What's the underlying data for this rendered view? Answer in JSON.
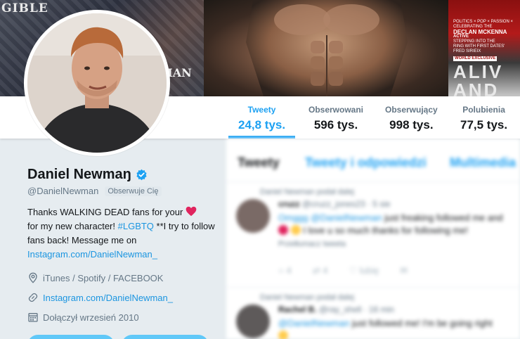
{
  "banner": {
    "left_text_top": "GIBLE",
    "left_text_bottom": "MAN",
    "magazine": {
      "line1": "POLITICS × POP × PASSION ×",
      "line2": "CELEBRATING THE",
      "line3": "DECLAN MCKENNA",
      "line4": "ACTIVE",
      "line5": "STEPPING INTO THE",
      "line6": "RING WITH FIRST DATES'",
      "line7": "FRED SIRIEIX",
      "exclusive": "WORLD EXCLUSIVE",
      "big1": "ALIV",
      "big2": "AND"
    }
  },
  "nav": {
    "stats": [
      {
        "label": "Tweety",
        "value": "24,8 tys."
      },
      {
        "label": "Obserwowani",
        "value": "596 tys."
      },
      {
        "label": "Obserwujący",
        "value": "998 tys."
      },
      {
        "label": "Polubienia",
        "value": "77,5 tys."
      }
    ]
  },
  "profile": {
    "name": "Daniel Newmaŋ",
    "handle": "@DanielNewman",
    "follows_you": "Obserwuje Cię",
    "bio": {
      "part1": "Thanks WALKING DEAD fans for your",
      "part2": "for my new character!",
      "hashtag": "#LGBTQ",
      "part3": "**I try to follow fans back! Message me on",
      "link": "Instagram.com/DanielNewman_"
    },
    "location": "iTunes / Spotify / FACEBOOK",
    "website": "Instagram.com/DanielNewman_",
    "joined": "Dołączył wrzesień 2010"
  },
  "timeline": {
    "tabs": [
      "Tweety",
      "Tweety i odpowiedzi",
      "Multimedia"
    ],
    "tweets": [
      {
        "retweeted_by": "Daniel Newman podał dalej",
        "author": "cruzz",
        "meta": "@cruzz_jones23 · 5 sie",
        "text_mention": "Omggg @DanielNewman",
        "text": "just freaking followed me and",
        "text2": "I love u so much thanks for following me!",
        "tag": "Przetłumacz tweeta",
        "actions": [
          "4",
          "4",
          "lubię",
          ""
        ]
      },
      {
        "retweeted_by": "Daniel Newman podał dalej",
        "author": "Rachel B.",
        "meta": "@ray_shell · 16 min",
        "text_mention": "@DanielNewman",
        "text": "just followed me! I'm be going right",
        "actions": []
      }
    ]
  }
}
